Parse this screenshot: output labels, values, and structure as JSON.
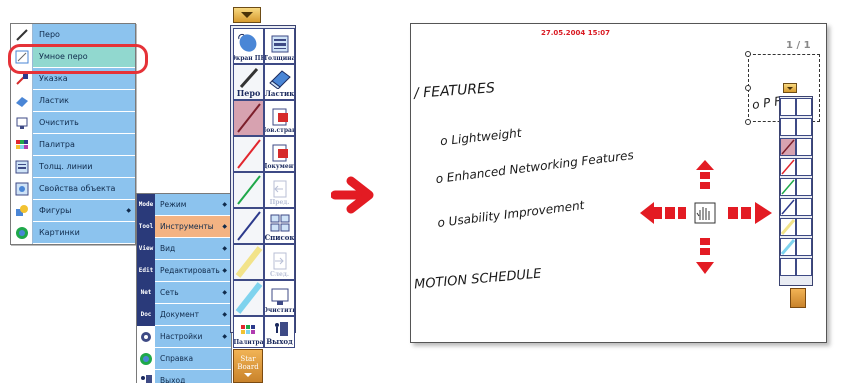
{
  "menu": {
    "items": [
      {
        "label": "Перо",
        "icon": "pen-icon"
      },
      {
        "label": "Умное перо",
        "icon": "smart-pen-icon",
        "selected": true
      },
      {
        "label": "Указка",
        "icon": "pointer-icon"
      },
      {
        "label": "Ластик",
        "icon": "eraser-icon"
      },
      {
        "label": "Очистить",
        "icon": "clear-icon"
      },
      {
        "label": "Палитра",
        "icon": "palette-icon"
      },
      {
        "label": "Толщ. линии",
        "icon": "line-width-icon"
      },
      {
        "label": "Свойства объекта",
        "icon": "object-properties-icon"
      },
      {
        "label": "Фигуры",
        "icon": "shapes-icon",
        "submenu": true
      },
      {
        "label": "Картинки",
        "icon": "pictures-icon"
      }
    ]
  },
  "submenu": {
    "items": [
      {
        "tag": "Mode",
        "label": "Режим",
        "submenu": true
      },
      {
        "tag": "Tool",
        "label": "Инструменты",
        "submenu": true,
        "selected": true
      },
      {
        "tag": "View",
        "label": "Вид",
        "submenu": true
      },
      {
        "tag": "Edit",
        "label": "Редактировать",
        "submenu": true
      },
      {
        "tag": "Net",
        "label": "Сеть",
        "submenu": true
      },
      {
        "tag": "Doc",
        "label": "Документ",
        "submenu": true
      },
      {
        "tag": "",
        "label": "Настройки",
        "submenu": true
      },
      {
        "tag": "",
        "label": "Справка"
      },
      {
        "tag": "",
        "label": "Выход"
      }
    ]
  },
  "toolbar": {
    "screen_pc": "Экран ПК",
    "thickness": "Толщина",
    "pen": "Перо",
    "eraser": "Ластик",
    "new_page": "Нов.стран.",
    "document": "Документ",
    "prev": "Пред.",
    "list": "Список",
    "next": "След.",
    "clear": "Очистить",
    "palette": "Палитра",
    "exit": "Выход",
    "star1": "Star",
    "star2": "Board"
  },
  "board": {
    "date": "27.05.2004 15:07",
    "page": "1 / 1",
    "lines": [
      "/ FEATURES",
      "o Lightweight",
      "o Enhanced Networking Features",
      "o Usability Improvement",
      "MOTION SCHEDULE"
    ],
    "partial": "o P     F"
  },
  "colors": {
    "menu_bg": "#8cc3ee",
    "selected": "#91d8cf",
    "highlight": "#e53238",
    "arrow": "#e31b23"
  }
}
